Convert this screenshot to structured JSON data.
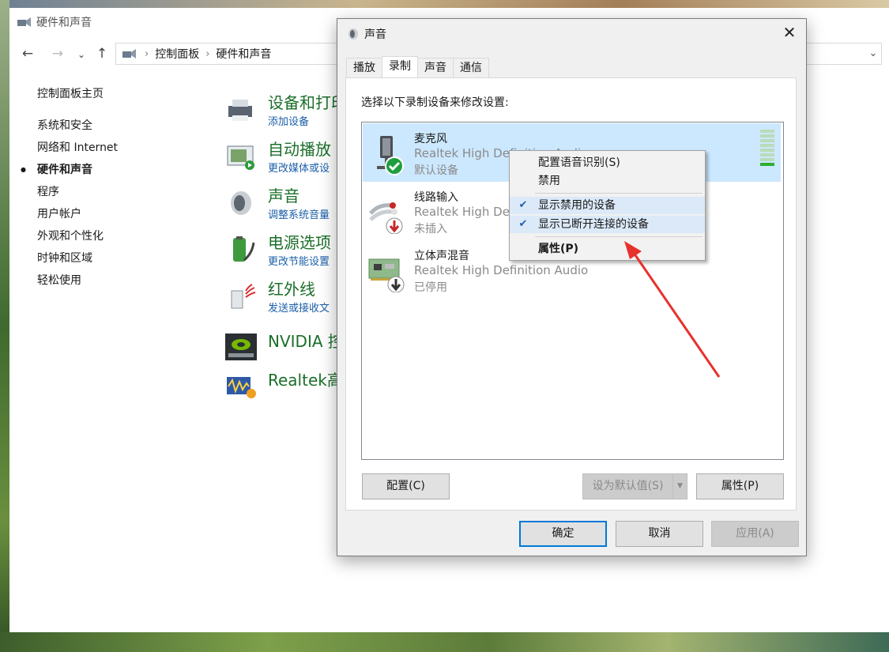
{
  "control_panel": {
    "window_title": "硬件和声音",
    "breadcrumb": [
      "控制面板",
      "硬件和声音"
    ],
    "sidebar": [
      {
        "label": "控制面板主页",
        "active": false
      },
      {
        "label": "系统和安全",
        "active": false
      },
      {
        "label": "网络和 Internet",
        "active": false
      },
      {
        "label": "硬件和声音",
        "active": true
      },
      {
        "label": "程序",
        "active": false
      },
      {
        "label": "用户帐户",
        "active": false
      },
      {
        "label": "外观和个性化",
        "active": false
      },
      {
        "label": "时钟和区域",
        "active": false
      },
      {
        "label": "轻松使用",
        "active": false
      }
    ],
    "categories": [
      {
        "title": "设备和打印",
        "sub": "添加设备",
        "icon": "printer-icon"
      },
      {
        "title": "自动播放",
        "sub": "更改媒体或设",
        "icon": "autoplay-icon"
      },
      {
        "title": "声音",
        "sub": "调整系统音量",
        "icon": "speaker-icon"
      },
      {
        "title": "电源选项",
        "sub": "更改节能设置",
        "icon": "battery-icon"
      },
      {
        "title": "红外线",
        "sub": "发送或接收文",
        "icon": "infrared-icon"
      },
      {
        "title": "NVIDIA 控",
        "sub": "",
        "icon": "nvidia-icon"
      },
      {
        "title": "Realtek高",
        "sub": "",
        "icon": "realtek-icon"
      }
    ]
  },
  "dialog": {
    "title": "声音",
    "tabs": [
      "播放",
      "录制",
      "声音",
      "通信"
    ],
    "active_tab": "录制",
    "instruction": "选择以下录制设备来修改设置:",
    "devices": [
      {
        "name": "麦克风",
        "driver": "Realtek High Definition Audio",
        "status": "默认设备",
        "selected": true
      },
      {
        "name": "线路输入",
        "driver": "Realtek High Definition Audio",
        "status": "未插入",
        "selected": false
      },
      {
        "name": "立体声混音",
        "driver": "Realtek High Definition Audio",
        "status": "已停用",
        "selected": false
      }
    ],
    "buttons": {
      "configure": "配置(C)",
      "set_default": "设为默认值(S)",
      "properties": "属性(P)",
      "ok": "确定",
      "cancel": "取消",
      "apply": "应用(A)"
    }
  },
  "context_menu": {
    "items": [
      {
        "label": "配置语音识别(S)",
        "checked": false,
        "bold": false
      },
      {
        "label": "禁用",
        "checked": false,
        "bold": false
      },
      {
        "label": "显示禁用的设备",
        "checked": true,
        "bold": false
      },
      {
        "label": "显示已断开连接的设备",
        "checked": true,
        "bold": false
      },
      {
        "label": "属性(P)",
        "checked": false,
        "bold": true
      }
    ]
  },
  "colors": {
    "accent": "#0078d7",
    "link_green": "#1b6f2a",
    "link_blue": "#1b5fa8",
    "selection": "#cce8ff",
    "annotation_arrow": "#e8312c"
  }
}
